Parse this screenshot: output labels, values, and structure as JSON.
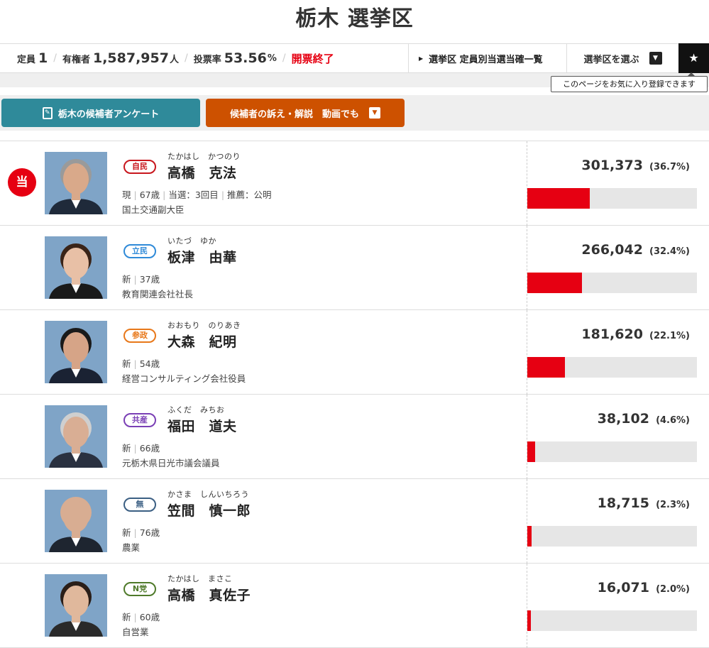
{
  "title": "栃木 選挙区",
  "stats": {
    "seats_label": "定員",
    "seats": "1",
    "voters_label": "有権者",
    "voters": "1,587,957",
    "voters_unit": "人",
    "turnout_label": "投票率",
    "turnout": "53.56",
    "turnout_unit": "%",
    "status": "開票終了"
  },
  "nav": {
    "winners_list": "選挙区 定員別当選当確一覧",
    "district_select": "選挙区を選ぶ",
    "favorite_tooltip": "このページをお気に入り登録できます"
  },
  "buttons": {
    "survey": "栃木の候補者アンケート",
    "video": "候補者の訴え・解説　動画でも"
  },
  "win_mark": "当",
  "colors": {
    "accent_red": "#e60012",
    "survey": "#2f8a9a",
    "video": "#cd5100"
  },
  "candidates": [
    {
      "kana": "たかはし　かつのり",
      "name": "高橋　克法",
      "party": "自民",
      "party_color": "#c8161d",
      "winner": true,
      "details": [
        "現",
        "67歳",
        "当選：3回目",
        "推薦：公明"
      ],
      "title": "国土交通副大臣",
      "votes": "301,373",
      "pct": "(36.7%)",
      "share": 36.7,
      "photo": {
        "bg": "#7fa4c7",
        "skin": "#d9a98a",
        "hair": "#9a9a9a",
        "suit": "#1f2a3a"
      }
    },
    {
      "kana": "いたづ　ゆか",
      "name": "板津　由華",
      "party": "立民",
      "party_color": "#2f8ad8",
      "winner": false,
      "details": [
        "新",
        "37歳"
      ],
      "title": "教育関連会社社長",
      "votes": "266,042",
      "pct": "(32.4%)",
      "share": 32.4,
      "photo": {
        "bg": "#7fa4c7",
        "skin": "#e8c0a6",
        "hair": "#3a2418",
        "suit": "#1a1a1a"
      }
    },
    {
      "kana": "おおもり　のりあき",
      "name": "大森　紀明",
      "party": "参政",
      "party_color": "#e8781a",
      "winner": false,
      "details": [
        "新",
        "54歳"
      ],
      "title": "経営コンサルティング会社役員",
      "votes": "181,620",
      "pct": "(22.1%)",
      "share": 22.1,
      "photo": {
        "bg": "#7fa4c7",
        "skin": "#d6a487",
        "hair": "#1a1a1a",
        "suit": "#1a2233"
      }
    },
    {
      "kana": "ふくだ　みちお",
      "name": "福田　道夫",
      "party": "共産",
      "party_color": "#7a3fb5",
      "winner": false,
      "details": [
        "新",
        "66歳"
      ],
      "title": "元栃木県日光市議会議員",
      "votes": "38,102",
      "pct": "(4.6%)",
      "share": 4.6,
      "photo": {
        "bg": "#7fa4c7",
        "skin": "#d9ae94",
        "hair": "#cfcfcf",
        "suit": "#2a3140"
      }
    },
    {
      "kana": "かさま　しんいちろう",
      "name": "笠間　慎一郎",
      "party": "無",
      "party_color": "#3b5f83",
      "winner": false,
      "details": [
        "新",
        "76歳"
      ],
      "title": "農業",
      "votes": "18,715",
      "pct": "(2.3%)",
      "share": 2.3,
      "photo": {
        "bg": "#7fa4c7",
        "skin": "#d8ad92",
        "hair": "#d8ad92",
        "suit": "#1e2530"
      }
    },
    {
      "kana": "たかはし　まさこ",
      "name": "高橋　真佐子",
      "party": "N党",
      "party_color": "#4f7a2a",
      "winner": false,
      "details": [
        "新",
        "60歳"
      ],
      "title": "自営業",
      "votes": "16,071",
      "pct": "(2.0%)",
      "share": 2.0,
      "photo": {
        "bg": "#7fa4c7",
        "skin": "#e0b89c",
        "hair": "#2a1e18",
        "suit": "#2a2a2a"
      }
    }
  ]
}
